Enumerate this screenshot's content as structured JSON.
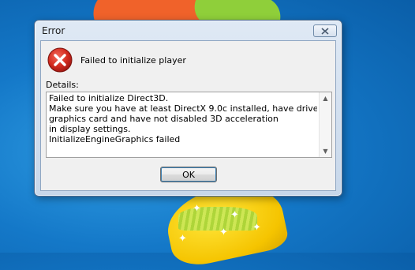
{
  "window": {
    "title": "Error",
    "close_icon": "close-icon",
    "message": "Failed to initialize player",
    "details_label": "Details:",
    "details_text": "Failed to initialize Direct3D.\nMake sure you have at least DirectX 9.0c installed, have drivers for yo\ngraphics card and have not disabled 3D acceleration\nin display settings.\nInitializeEngineGraphics failed",
    "ok_label": "OK",
    "error_icon": "error-icon"
  },
  "colors": {
    "desktop_blue": "#1478c8",
    "error_red": "#c8261e",
    "accent_border": "#3c7fb1"
  }
}
